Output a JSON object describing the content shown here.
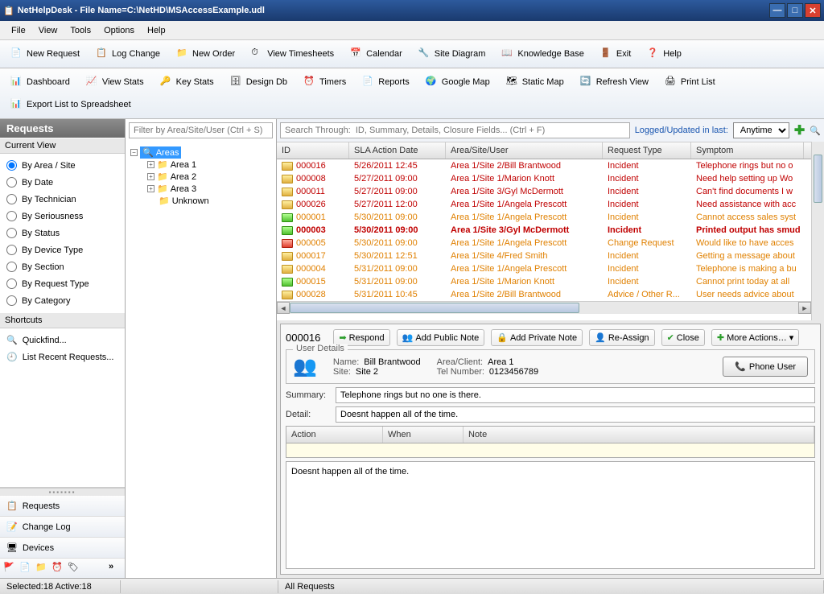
{
  "window": {
    "title": "NetHelpDesk - File Name=C:\\NetHD\\MSAccessExample.udl"
  },
  "menu": [
    "File",
    "View",
    "Tools",
    "Options",
    "Help"
  ],
  "toolbar1": [
    {
      "label": "New Request",
      "icon": "new-request-icon"
    },
    {
      "label": "Log Change",
      "icon": "log-change-icon"
    },
    {
      "label": "New Order",
      "icon": "new-order-icon"
    },
    {
      "label": "View Timesheets",
      "icon": "timesheet-icon"
    },
    {
      "label": "Calendar",
      "icon": "calendar-icon"
    },
    {
      "label": "Site Diagram",
      "icon": "diagram-icon"
    },
    {
      "label": "Knowledge Base",
      "icon": "kb-icon"
    },
    {
      "label": "Exit",
      "icon": "exit-icon"
    },
    {
      "label": "Help",
      "icon": "help-icon"
    }
  ],
  "toolbar2": [
    {
      "label": "Dashboard",
      "icon": "dashboard-icon"
    },
    {
      "label": "View Stats",
      "icon": "stats-icon"
    },
    {
      "label": "Key Stats",
      "icon": "keystats-icon"
    },
    {
      "label": "Design Db",
      "icon": "designdb-icon"
    },
    {
      "label": "Timers",
      "icon": "timers-icon"
    },
    {
      "label": "Reports",
      "icon": "reports-icon"
    },
    {
      "label": "Google Map",
      "icon": "gmap-icon"
    },
    {
      "label": "Static Map",
      "icon": "smap-icon"
    },
    {
      "label": "Refresh View",
      "icon": "refresh-icon"
    },
    {
      "label": "Print List",
      "icon": "print-icon"
    },
    {
      "label": "Export List to Spreadsheet",
      "icon": "export-icon"
    }
  ],
  "left": {
    "title": "Requests",
    "current_view_label": "Current View",
    "views": [
      "By Area / Site",
      "By Date",
      "By Technician",
      "By Seriousness",
      "By Status",
      "By Device Type",
      "By Section",
      "By Request Type",
      "By Category"
    ],
    "selected_view": 0,
    "shortcuts_label": "Shortcuts",
    "shortcuts": [
      "Quickfind...",
      "List Recent Requests..."
    ],
    "nav": [
      "Requests",
      "Change Log",
      "Devices"
    ]
  },
  "tree": {
    "filter_placeholder": "Filter by Area/Site/User (Ctrl + S)",
    "root": "Areas",
    "items": [
      "Area 1",
      "Area 2",
      "Area 3",
      "Unknown"
    ]
  },
  "search": {
    "placeholder": "Search Through:  ID, Summary, Details, Closure Fields... (Ctrl + F)",
    "logged_label": "Logged/Updated in last:",
    "dropdown_value": "Anytime"
  },
  "grid": {
    "columns": [
      "ID",
      "SLA Action Date",
      "Area/Site/User",
      "Request Type",
      "Symptom"
    ],
    "rows": [
      {
        "id": "000016",
        "date": "5/26/2011 12:45",
        "area": "Area 1/Site 2/Bill Brantwood",
        "type": "Incident",
        "sym": "Telephone rings but no o",
        "cls": "red",
        "f": "yellow"
      },
      {
        "id": "000008",
        "date": "5/27/2011 09:00",
        "area": "Area 1/Site 1/Marion Knott",
        "type": "Incident",
        "sym": "Need help setting up Wo",
        "cls": "red",
        "f": "yellow"
      },
      {
        "id": "000011",
        "date": "5/27/2011 09:00",
        "area": "Area 1/Site 3/Gyl McDermott",
        "type": "Incident",
        "sym": "Can't find documents I w",
        "cls": "red",
        "f": "yellow"
      },
      {
        "id": "000026",
        "date": "5/27/2011 12:00",
        "area": "Area 1/Site 1/Angela Prescott",
        "type": "Incident",
        "sym": "Need assistance with acc",
        "cls": "red",
        "f": "yellow"
      },
      {
        "id": "000001",
        "date": "5/30/2011 09:00",
        "area": "Area 1/Site 1/Angela Prescott",
        "type": "Incident",
        "sym": "Cannot access sales syst",
        "cls": "orange",
        "f": "green"
      },
      {
        "id": "000003",
        "date": "5/30/2011 09:00",
        "area": "Area 1/Site 3/Gyl McDermott",
        "type": "Incident",
        "sym": "Printed output has smud",
        "cls": "redbold",
        "f": "green"
      },
      {
        "id": "000005",
        "date": "5/30/2011 09:00",
        "area": "Area 1/Site 1/Angela Prescott",
        "type": "Change Request",
        "sym": "Would like to have acces",
        "cls": "orange",
        "f": "red"
      },
      {
        "id": "000017",
        "date": "5/30/2011 12:51",
        "area": "Area 1/Site 4/Fred Smith",
        "type": "Incident",
        "sym": "Getting a message about",
        "cls": "orange",
        "f": "yellow"
      },
      {
        "id": "000004",
        "date": "5/31/2011 09:00",
        "area": "Area 1/Site 1/Angela Prescott",
        "type": "Incident",
        "sym": "Telephone is making a bu",
        "cls": "orange",
        "f": "yellow"
      },
      {
        "id": "000015",
        "date": "5/31/2011 09:00",
        "area": "Area 1/Site 1/Marion Knott",
        "type": "Incident",
        "sym": "Cannot print today at all",
        "cls": "orange",
        "f": "green"
      },
      {
        "id": "000028",
        "date": "5/31/2011 10:45",
        "area": "Area 1/Site 2/Bill Brantwood",
        "type": "Advice / Other R...",
        "sym": "User needs advice about",
        "cls": "orange",
        "f": "yellow"
      }
    ]
  },
  "detail": {
    "id": "000016",
    "actions": [
      "Respond",
      "Add Public Note",
      "Add Private Note",
      "Re-Assign",
      "Close",
      "More Actions…"
    ],
    "user_details_label": "User Details",
    "name_label": "Name:",
    "name": "Bill Brantwood",
    "site_label": "Site:",
    "site": "Site 2",
    "area_label": "Area/Client:",
    "area": "Area 1",
    "tel_label": "Tel Number:",
    "tel": "0123456789",
    "phone_user": "Phone User",
    "summary_label": "Summary:",
    "summary": "Telephone rings but no one is there.",
    "detail_label": "Detail:",
    "detail_text": "Doesnt happen all of the time.",
    "sub_columns": [
      "Action",
      "When",
      "Note"
    ],
    "big_text": "Doesnt happen all of the time."
  },
  "status": {
    "left": "Selected:18  Active:18",
    "right": "All Requests"
  }
}
